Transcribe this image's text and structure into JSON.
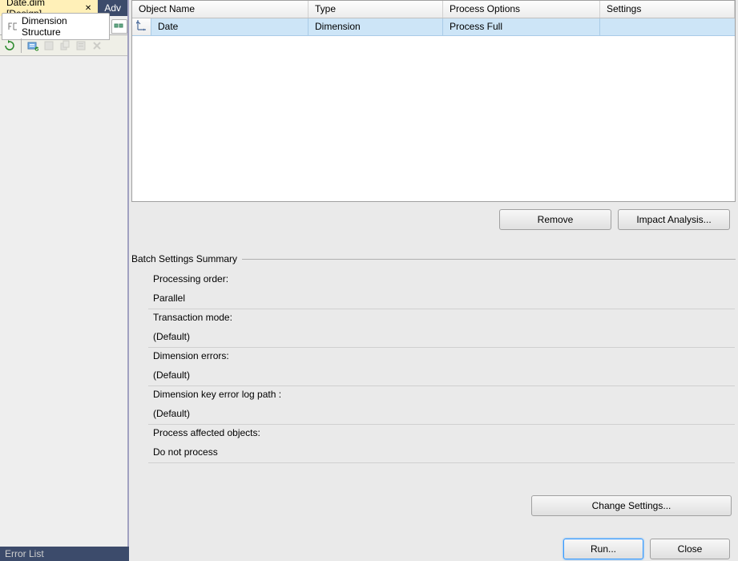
{
  "tabs": {
    "active": "Date.dim [Design]",
    "inactive": "Adv"
  },
  "subtab": "Dimension Structure",
  "grid": {
    "headers": [
      "Object Name",
      "Type",
      "Process Options",
      "Settings"
    ],
    "row": {
      "objectName": "Date",
      "type": "Dimension",
      "processOptions": "Process Full",
      "settings": ""
    }
  },
  "buttons": {
    "remove": "Remove",
    "impact": "Impact Analysis...",
    "changeSettings": "Change Settings...",
    "run": "Run...",
    "close": "Close"
  },
  "section": "Batch Settings Summary",
  "summary": {
    "labels": {
      "processingOrder": "Processing order:",
      "transactionMode": "Transaction mode:",
      "dimensionErrors": "Dimension errors:",
      "dimensionKeyErrorLog": "Dimension key error log path :",
      "processAffected": "Process affected objects:"
    },
    "values": {
      "processingOrder": "Parallel",
      "transactionMode": "(Default)",
      "dimensionErrors": "(Default)",
      "dimensionKeyErrorLog": "(Default)",
      "processAffected": "Do not process"
    }
  },
  "footer": "Error List"
}
